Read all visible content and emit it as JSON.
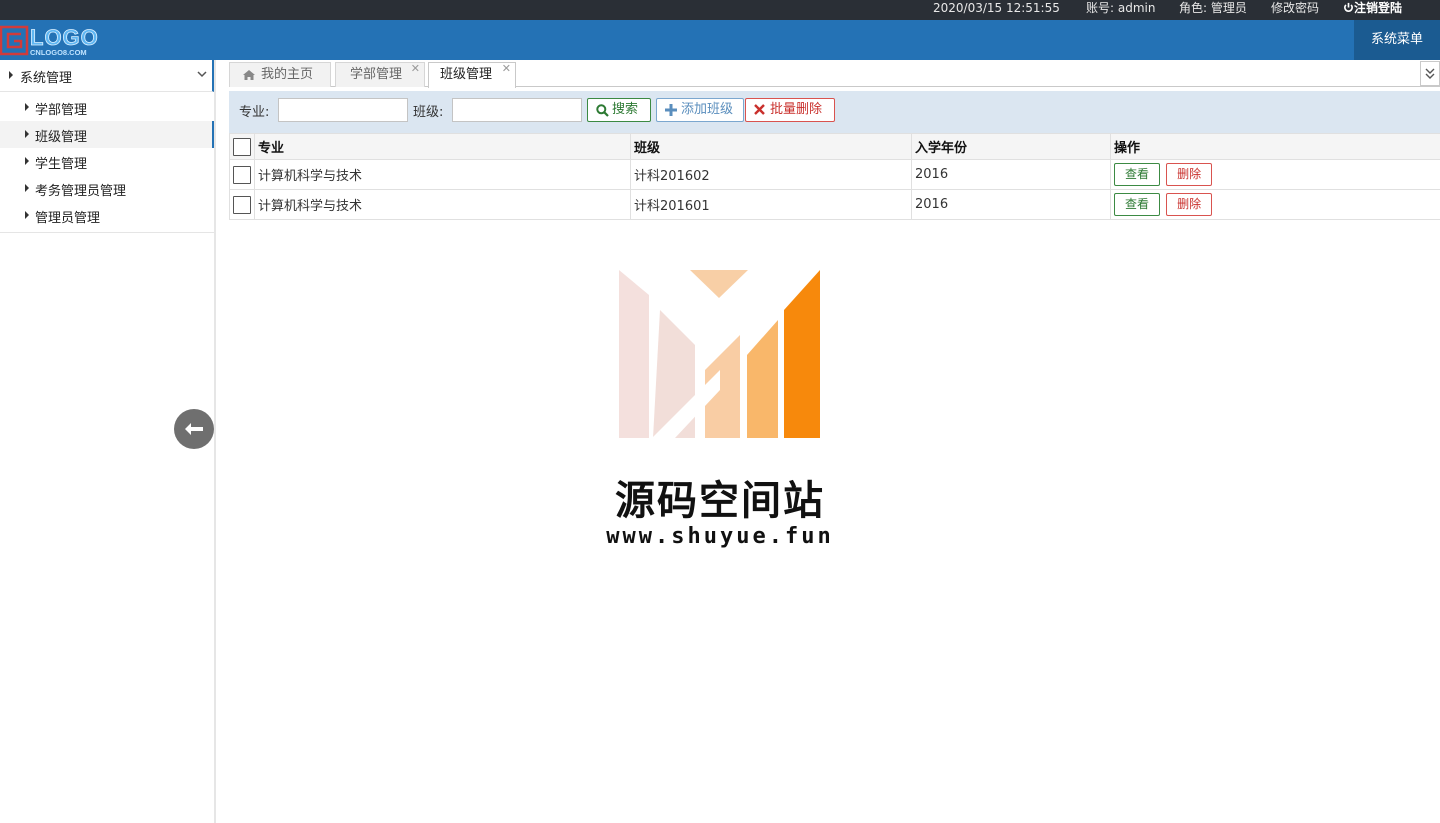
{
  "topbar": {
    "datetime": "2020/03/15 12:51:55",
    "account": "账号: admin",
    "role": "角色: 管理员",
    "change_password": "修改密码",
    "logout": "注销登陆"
  },
  "header": {
    "logo_text": "LOGO",
    "logo_subtext": "CNLOGO8.COM",
    "system_menu": "系统菜单"
  },
  "sidebar": {
    "group_label": "系统管理",
    "items": [
      {
        "label": "学部管理",
        "active": false
      },
      {
        "label": "班级管理",
        "active": true
      },
      {
        "label": "学生管理",
        "active": false
      },
      {
        "label": "考务管理员管理",
        "active": false
      },
      {
        "label": "管理员管理",
        "active": false
      }
    ]
  },
  "tabs": [
    {
      "label": "我的主页",
      "icon": "home-icon",
      "closable": false
    },
    {
      "label": "学部管理",
      "closable": true
    },
    {
      "label": "班级管理",
      "closable": true,
      "active": true
    }
  ],
  "toolbar": {
    "major_label": "专业:",
    "major_value": "",
    "class_label": "班级:",
    "class_value": "",
    "search": "搜索",
    "add": "添加班级",
    "batch_delete": "批量删除"
  },
  "table": {
    "columns": [
      "专业",
      "班级",
      "入学年份",
      "操作"
    ],
    "rows": [
      {
        "major": "计算机科学与技术",
        "class": "计科201602",
        "year": "2016"
      },
      {
        "major": "计算机科学与技术",
        "class": "计科201601",
        "year": "2016"
      }
    ],
    "view_label": "查看",
    "delete_label": "删除"
  },
  "watermark": {
    "title": "源码空间站",
    "url": "www.shuyue.fun"
  },
  "colors": {
    "header_blue": "#2472b5",
    "topbar_dark": "#2a2f36",
    "toolbar_bg": "#dbe6f1",
    "accent_orange": "#f7890c"
  }
}
